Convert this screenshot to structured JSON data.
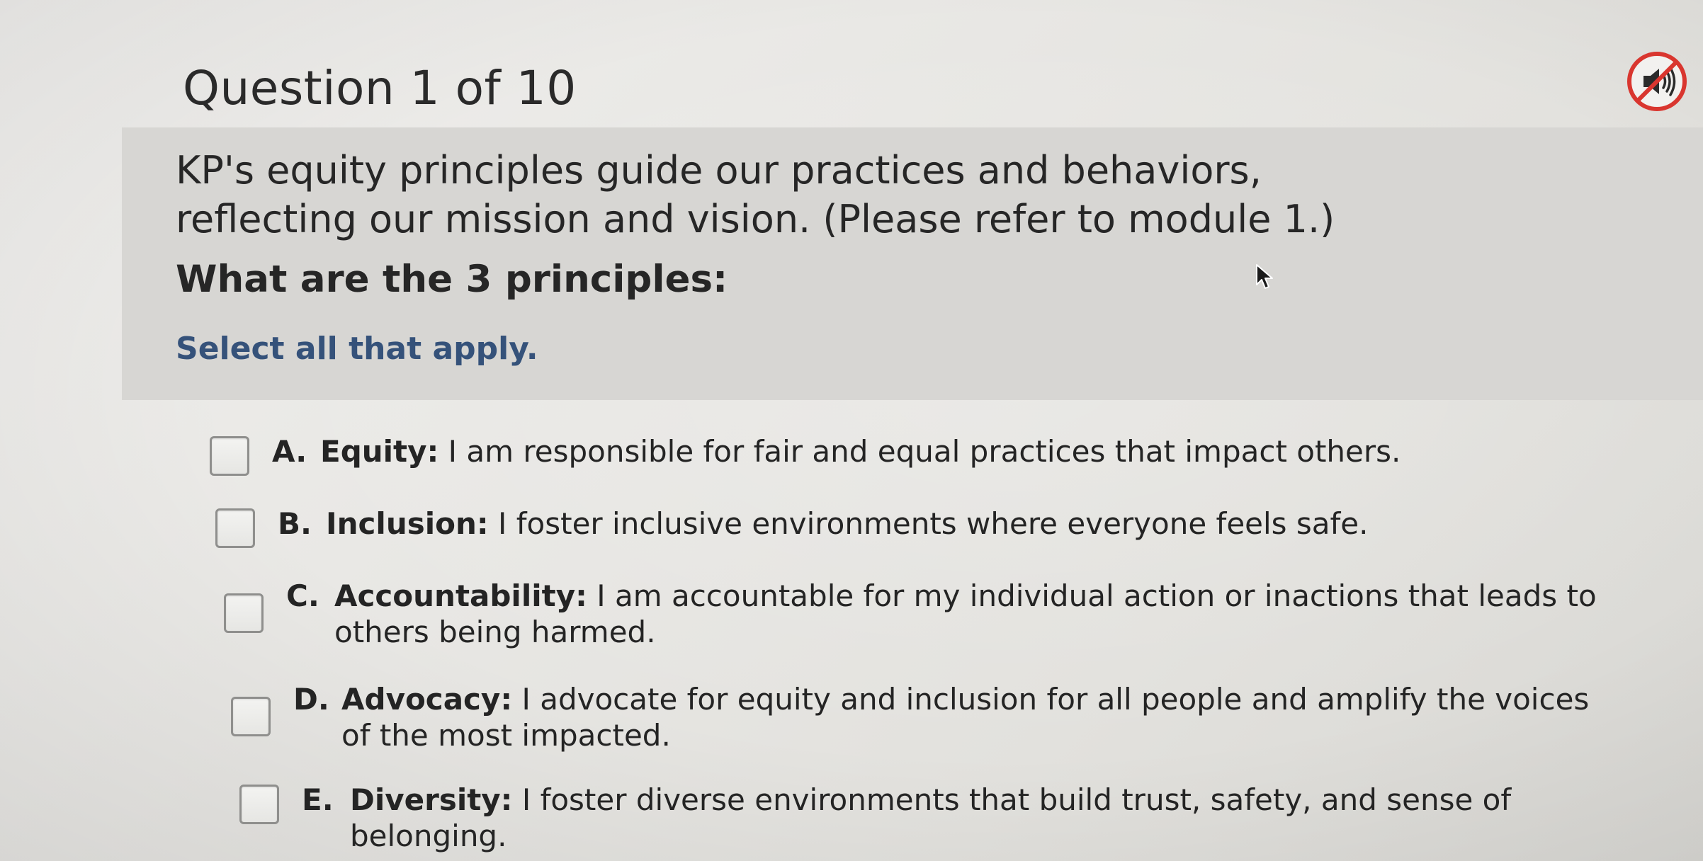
{
  "header": {
    "title": "Question 1 of 10"
  },
  "audio": {
    "icon": "muted-speaker-icon",
    "accent_color": "#d9362f"
  },
  "question": {
    "line1": "KP's equity principles guide our practices and behaviors,",
    "line2": "reflecting our mission and vision. (Please refer to module 1.)",
    "prompt": "What are the 3 principles:",
    "instruction": "Select all that apply."
  },
  "options": [
    {
      "letter": "A.",
      "term": "Equity:",
      "text": " I am responsible for fair and equal practices that impact others.",
      "checked": false
    },
    {
      "letter": "B.",
      "term": "Inclusion:",
      "text": " I foster inclusive environments where everyone feels safe.",
      "checked": false
    },
    {
      "letter": "C.",
      "term": "Accountability:",
      "text": " I am accountable for my individual action or inactions that leads to others being harmed.",
      "checked": false
    },
    {
      "letter": "D.",
      "term": "Advocacy:",
      "text": " I advocate for equity and inclusion for all people and amplify the voices of the most impacted.",
      "checked": false
    },
    {
      "letter": "E.",
      "term": "Diversity:",
      "text": " I foster diverse environments that build trust, safety, and sense of belonging.",
      "checked": false
    }
  ],
  "colors": {
    "panel_bg": "#d7d6d3",
    "instruction_text": "#35527a"
  }
}
